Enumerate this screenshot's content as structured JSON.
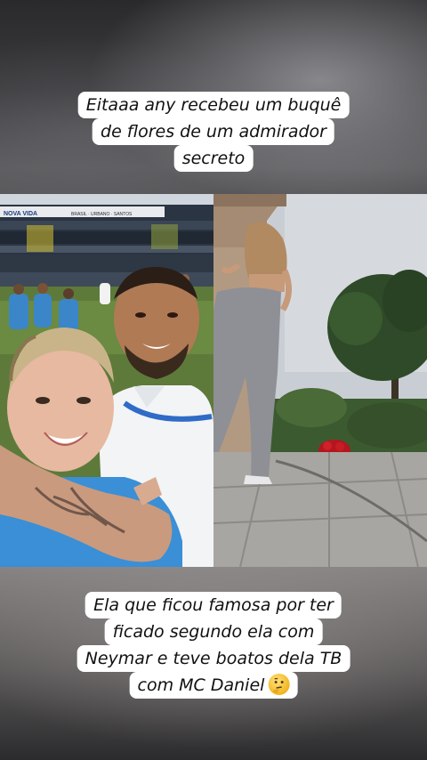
{
  "caption_top": {
    "lines": [
      "Eitaaa any recebeu um buquê",
      "de flores de um admirador",
      "secreto"
    ]
  },
  "caption_bottom": {
    "lines": [
      "Ela que ficou famosa por ter",
      "ficado segundo ela com",
      "Neymar e teve boatos dela TB",
      "com MC Daniel"
    ],
    "emoji": "thinking-face-emoji"
  },
  "photo_left": {
    "description_icon": "selfie-stadium-photo",
    "stadium_sign": "NOVA VIDA",
    "stadium_sign_2": "BRASIL ·  URBANO · SANTOS"
  },
  "photo_right": {
    "description_icon": "patio-flowers-photo"
  }
}
